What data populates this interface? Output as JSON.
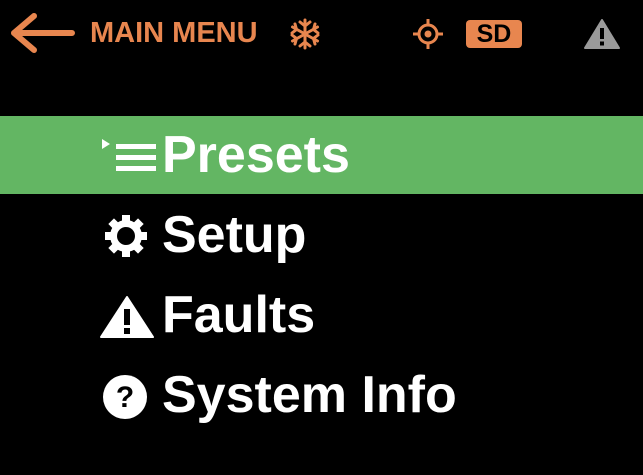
{
  "colors": {
    "accent": "#e8864f",
    "selected_background": "#63b663",
    "background": "#000000",
    "menu_text": "#ffffff",
    "muted_icon": "#9a9a9a"
  },
  "header": {
    "back_icon": "left-arrow-icon",
    "title": "MAIN MENU",
    "status_icons": [
      "snowflake-icon",
      "target-icon",
      "sd-card-badge",
      "warning-icon"
    ],
    "sd_label": "SD"
  },
  "menu": {
    "selected_index": 0,
    "items": [
      {
        "label": "Presets",
        "icon": "presets-list-icon"
      },
      {
        "label": "Setup",
        "icon": "gear-icon"
      },
      {
        "label": "Faults",
        "icon": "warning-icon"
      },
      {
        "label": "System Info",
        "icon": "help-icon"
      }
    ]
  }
}
